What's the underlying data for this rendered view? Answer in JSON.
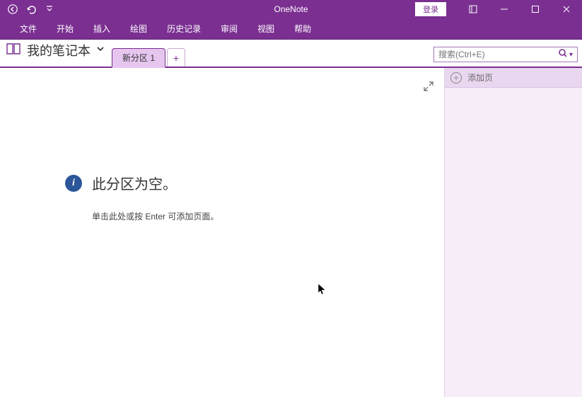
{
  "titlebar": {
    "app_title": "OneNote",
    "login_label": "登录"
  },
  "ribbon": {
    "tabs": [
      "文件",
      "开始",
      "插入",
      "绘图",
      "历史记录",
      "审阅",
      "视图",
      "帮助"
    ]
  },
  "notebook": {
    "name": "我的笔记本",
    "section_tab": "新分区 1",
    "search_placeholder": "搜索(Ctrl+E)"
  },
  "content": {
    "empty_title": "此分区为空。",
    "empty_sub": "单击此处或按 Enter 可添加页面。"
  },
  "pagepanel": {
    "add_page_label": "添加页"
  }
}
